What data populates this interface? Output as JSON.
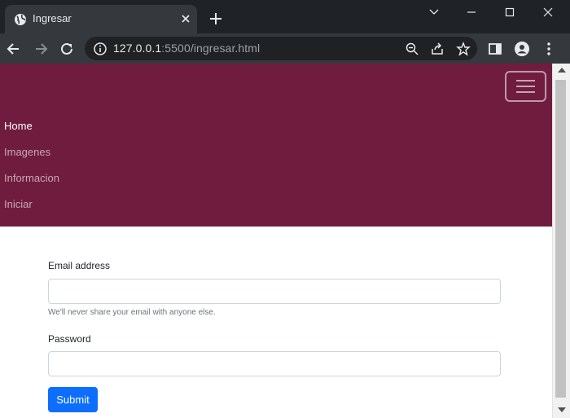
{
  "browser": {
    "tab_title": "Ingresar",
    "url_host": "127.0.0.1",
    "url_rest": ":5500/ingresar.html",
    "icons": [
      "globe-icon",
      "close-icon",
      "new-tab-icon",
      "back-icon",
      "forward-icon",
      "reload-icon",
      "info-icon",
      "zoom-icon",
      "share-icon",
      "star-icon",
      "side-panel-icon",
      "profile-icon",
      "menu-icon"
    ]
  },
  "navbar": {
    "background": "#701c3e",
    "links": [
      {
        "label": "Home"
      },
      {
        "label": "Imagenes"
      },
      {
        "label": "Informacion"
      },
      {
        "label": "Iniciar"
      }
    ]
  },
  "form": {
    "email_label": "Email address",
    "email_value": "",
    "email_help": "We'll never share your email with anyone else.",
    "password_label": "Password",
    "password_value": "",
    "submit_label": "Submit",
    "submit_color": "#0d6efd"
  }
}
